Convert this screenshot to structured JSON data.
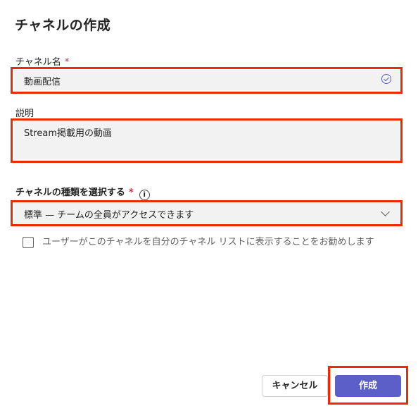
{
  "dialog": {
    "title": "チャネルの作成"
  },
  "channel_name": {
    "label": "チャネル名",
    "required_mark": "*",
    "value": "動画配信",
    "status_icon": "check-circle-icon"
  },
  "description": {
    "label": "説明",
    "value": "Stream掲載用の動画"
  },
  "channel_type": {
    "label": "チャネルの種類を選択する",
    "required_mark": "*",
    "info_icon": "i",
    "selected": "標準 — チームの全員がアクセスできます"
  },
  "show_checkbox": {
    "checked": false,
    "label": "ユーザーがこのチャネルを自分のチャネル リストに表示することをお勧めします"
  },
  "buttons": {
    "cancel": "キャンセル",
    "create": "作成"
  },
  "colors": {
    "highlight": "#ee2a00",
    "primary": "#5b5fc7",
    "required": "#c4314b"
  }
}
